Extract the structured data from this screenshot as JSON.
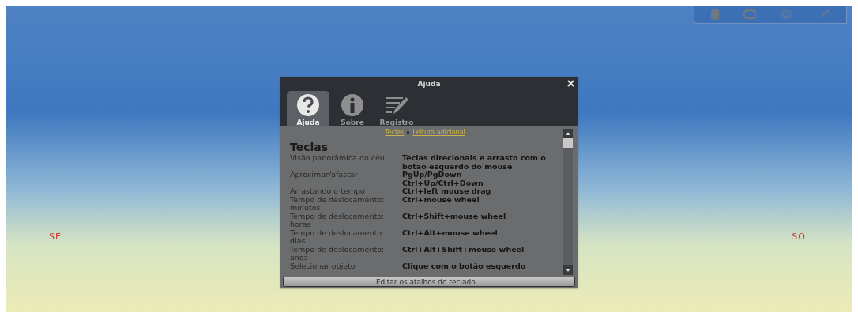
{
  "compass": [
    {
      "label": "SE"
    },
    {
      "label": "SO"
    }
  ],
  "dialog": {
    "title": "Ajuda",
    "tabs": [
      {
        "label": "Ajuda",
        "kind": "help",
        "selected": true
      },
      {
        "label": "Sobre",
        "kind": "info",
        "selected": false
      },
      {
        "label": "Registro",
        "kind": "log",
        "selected": false
      }
    ],
    "links": [
      "Teclas",
      "Leitura adicional"
    ],
    "heading": "Teclas",
    "rows": [
      {
        "action": "Visão panorâmica do céu",
        "keys": "Teclas direcionais e arrasto com o botão esquerdo do mouse"
      },
      {
        "action": "Aproximar/afastar",
        "keys": "PgUp/PgDown\nCtrl+Up/Ctrl+Down"
      },
      {
        "action": "Arrastando o tempo",
        "keys": "Ctrl+left mouse drag"
      },
      {
        "action": "Tempo de deslocamento: minutos",
        "keys": "Ctrl+mouse wheel"
      },
      {
        "action": "Tempo de deslocamento: horas",
        "keys": "Ctrl+Shift+mouse wheel"
      },
      {
        "action": "Tempo de deslocamento: dias",
        "keys": "Ctrl+Alt+mouse wheel"
      },
      {
        "action": "Tempo de deslocamento: anos",
        "keys": "Ctrl+Alt+Shift+mouse wheel"
      },
      {
        "action": "Selecionar objeto",
        "keys": "Clique com o botão esquerdo"
      }
    ],
    "button": "Editar os atalhos do teclado..."
  }
}
